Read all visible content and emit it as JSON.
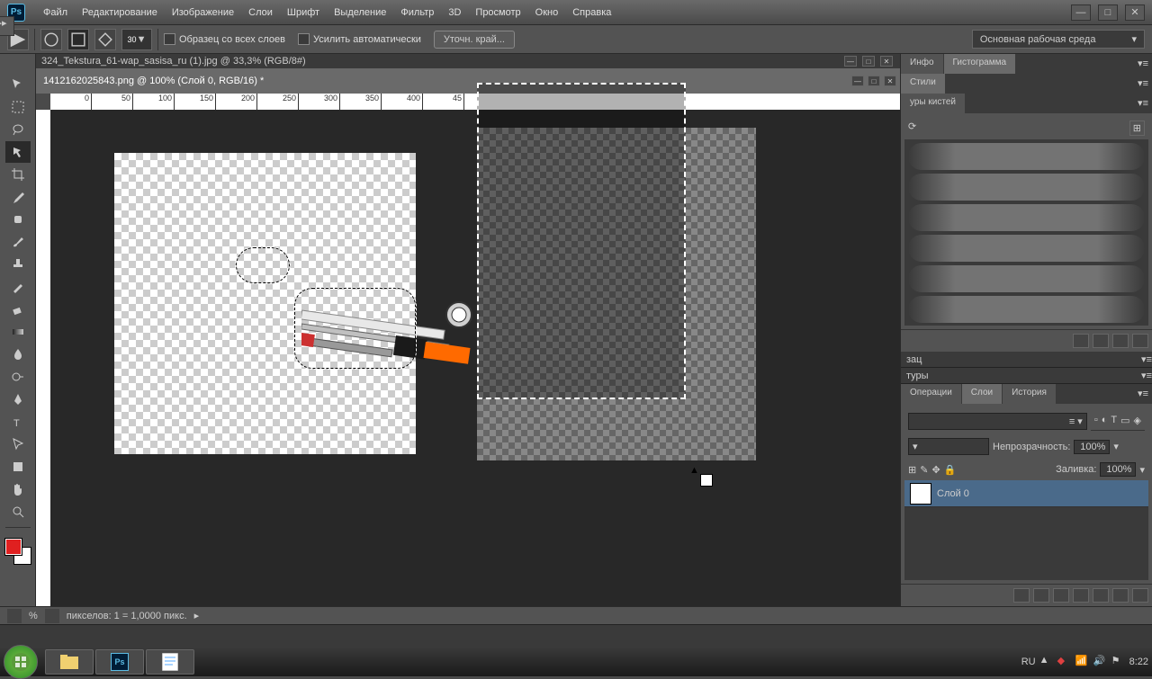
{
  "app": {
    "logo": "Ps"
  },
  "menu": [
    "Файл",
    "Редактирование",
    "Изображение",
    "Слои",
    "Шрифт",
    "Выделение",
    "Фильтр",
    "3D",
    "Просмотр",
    "Окно",
    "Справка"
  ],
  "options": {
    "brush_size": "30",
    "sample_all": "Образец со всех слоев",
    "auto_enhance": "Усилить автоматически",
    "refine": "Уточн. край...",
    "workspace": "Основная рабочая среда"
  },
  "documents": {
    "bg_tab": "324_Tekstura_61-wap_sasisa_ru (1).jpg @ 33,3% (RGB/8#)",
    "active": "1412162025843.png @ 100% (Слой 0, RGB/16) *"
  },
  "ruler": {
    "marks": [
      "0",
      "50",
      "100",
      "150",
      "200",
      "250",
      "300",
      "350",
      "400",
      "45"
    ]
  },
  "panels": {
    "info": "Инфо",
    "histogram": "Гистограмма",
    "styles": "Стили",
    "brushes": "уры кистей",
    "actions_tab": "зац",
    "paths_tab": "туры",
    "ops": "Операции",
    "layers_tab": "Слои",
    "history": "История",
    "opacity_label": "Непрозрачность:",
    "opacity_val": "100%",
    "fill_label": "Заливка:",
    "fill_val": "100%",
    "layer0": "Слой 0"
  },
  "status": {
    "info": "пикселов: 1 = 1,0000 пикс.",
    "zoom": "%"
  },
  "taskbar": {
    "lang": "RU",
    "time": "8:22"
  }
}
